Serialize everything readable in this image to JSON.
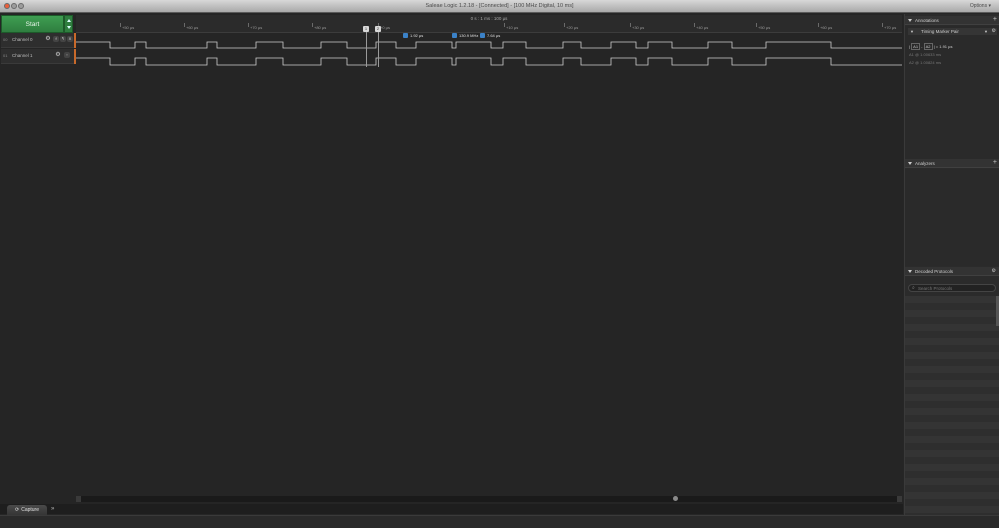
{
  "window": {
    "title": "Saleae Logic 1.2.18 - [Connected] - [100 MHz Digital, 10 ms]",
    "options_label": "Options ▾"
  },
  "capture": {
    "start_label": "Start",
    "tab_label": "Capture"
  },
  "ruler": {
    "center_label": "0 s : 1 ms : 100 µs",
    "ticks": [
      "+50 µs",
      "+60 µs",
      "+70 µs",
      "+80 µs",
      "+0 µs",
      "+10 µs",
      "+20 µs",
      "+30 µs",
      "+40 µs",
      "+50 µs",
      "+60 µs",
      "+70 µs"
    ]
  },
  "channels": [
    {
      "num": "00",
      "name": "Channel 0",
      "btn_a": "f",
      "btn_b": "↰",
      "btn_c": "X",
      "color": "#c8692a"
    },
    {
      "num": "01",
      "name": "Channel 1",
      "color": "#c8692a"
    }
  ],
  "markers": {
    "flag1": "1",
    "flag2": "2",
    "width": "1.92 µs",
    "freq": "130.9 MHz",
    "period": "7.64 µs"
  },
  "annotations": {
    "title": "Annotations",
    "timing_pair": "Timing Marker Pair",
    "pair_row": "| A1 - A2 | = 1.91 µs",
    "pair_a1": "A1",
    "pair_a2": "A2",
    "pair_value": "= 1.91 µs",
    "row_a1": "A1  @  1.00633 ms",
    "row_a2": "A2  @  1.00824 ms"
  },
  "analyzers": {
    "title": "Analyzers"
  },
  "decoded": {
    "title": "Decoded Protocols",
    "search_placeholder": "Search Protocols"
  },
  "colors": {
    "start_green": "#3f9e52",
    "channel_accent": "#c8692a",
    "measure_blue": "#3b82c8"
  }
}
